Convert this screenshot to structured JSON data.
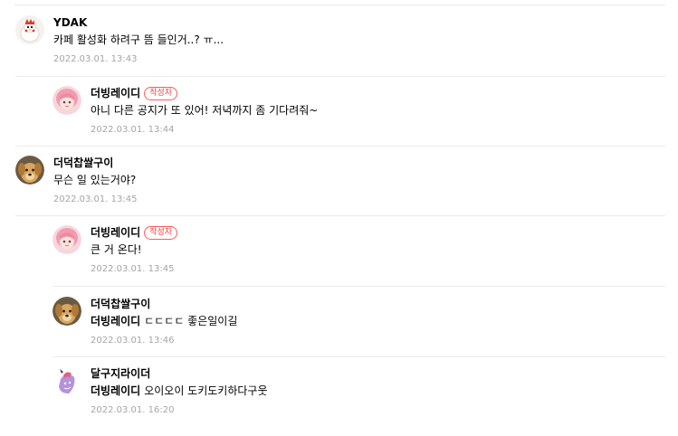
{
  "comments": [
    {
      "nickname": "YDAK",
      "text": "카페 활성화 하려구 뜸 들인거..? ㅠ...",
      "date": "2022.03.01. 13:43"
    },
    {
      "nickname": "더빙레이디",
      "badge": "작성자",
      "text": "아니 다른 공지가 또 있어! 저녁까지 좀 기다려줘~",
      "date": "2022.03.01. 13:44"
    },
    {
      "nickname": "더덕찹쌀구이",
      "text": "무슨 일 있는거야?",
      "date": "2022.03.01. 13:45"
    },
    {
      "nickname": "더빙레이디",
      "badge": "작성자",
      "text": "큰 거 온다!",
      "date": "2022.03.01. 13:45"
    },
    {
      "nickname": "더덕찹쌀구이",
      "mention": "더빙레이디",
      "text": "ㄷㄷㄷㄷ 좋은일이길",
      "date": "2022.03.01. 13:46"
    },
    {
      "nickname": "달구지라이더",
      "mention": "더빙레이디",
      "text": "오이오이 도키도키하다구웃",
      "date": "2022.03.01. 16:20"
    }
  ]
}
